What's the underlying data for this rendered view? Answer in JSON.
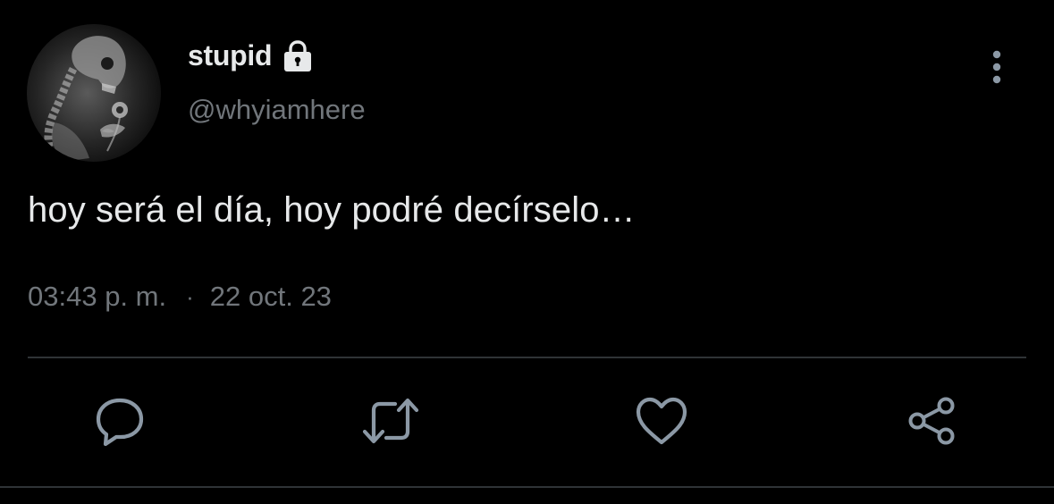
{
  "user": {
    "display_name": "stupid",
    "handle": "@whyiamhere",
    "protected": true,
    "avatar_icon": "skeleton-with-flower-avatar",
    "protected_icon": "lock-icon"
  },
  "tweet": {
    "text": "hoy será el día, hoy podré decírselo…",
    "time": "03:43 p. m.",
    "separator": "·",
    "date": "22 oct. 23"
  },
  "actions": [
    {
      "name": "reply",
      "icon": "reply-icon"
    },
    {
      "name": "retweet",
      "icon": "retweet-icon"
    },
    {
      "name": "like",
      "icon": "heart-icon"
    },
    {
      "name": "share",
      "icon": "share-icon"
    }
  ],
  "menu": {
    "icon": "more-vertical-icon"
  },
  "colors": {
    "background": "#000000",
    "primary_text": "#e7e9ea",
    "secondary_text": "#71767b",
    "divider": "#2f3336",
    "icon": "#8b98a5"
  }
}
